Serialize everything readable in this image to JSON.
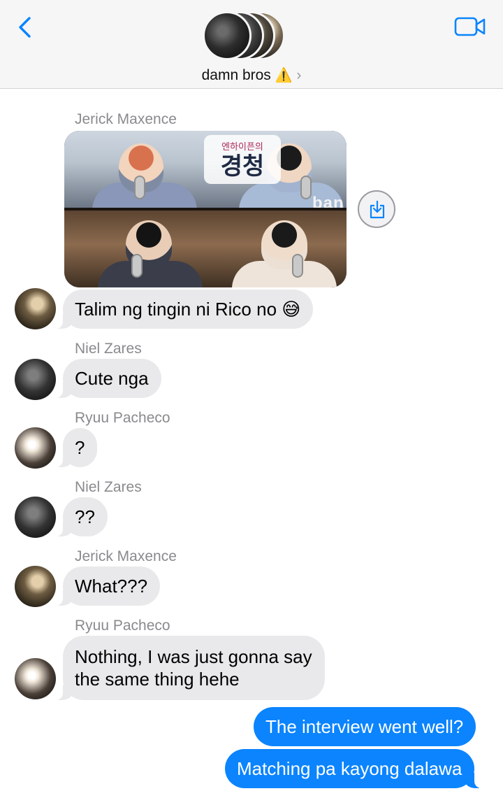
{
  "header": {
    "group_name": "damn bros",
    "warn_glyph": "⚠️",
    "chevron": "›",
    "back_icon": "chevron-left-icon",
    "video_icon": "video-camera-icon",
    "accent": "#0b84fe"
  },
  "photo": {
    "title_small": "엔하이픈의",
    "title_big": "경청",
    "watermark": "ban",
    "save_icon": "save-download-icon"
  },
  "messages": [
    {
      "sender": "Jerick Maxence",
      "text": "Talim ng tingin ni Rico no 😅"
    },
    {
      "sender": "Niel Zares",
      "text": "Cute nga"
    },
    {
      "sender": "Ryuu Pacheco",
      "text": "?"
    },
    {
      "sender": "Niel Zares",
      "text": "??"
    },
    {
      "sender": "Jerick Maxence",
      "text": "What???"
    },
    {
      "sender": "Ryuu Pacheco",
      "text_line1": "Nothing, I was just gonna say",
      "text_line2": "the same thing hehe"
    },
    {
      "sender": "me",
      "text": "The interview went well?"
    },
    {
      "sender": "me",
      "text": "Matching pa kayong dalawa"
    }
  ]
}
